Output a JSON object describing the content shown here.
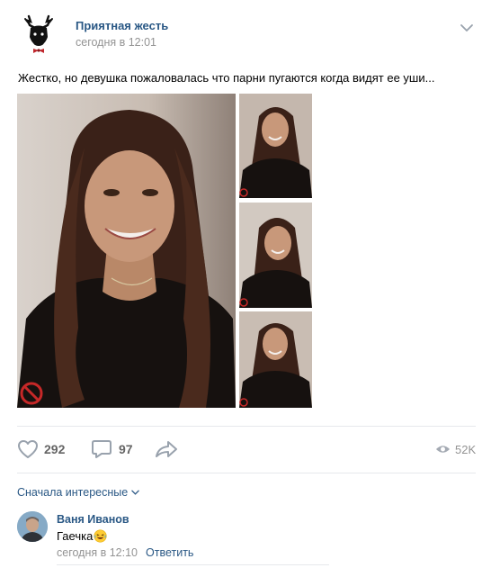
{
  "post": {
    "group_name": "Приятная жесть",
    "time": "сегодня в 12:01",
    "text": "Жестко, но девушка пожаловалась что парни пугаются когда видят ее уши..."
  },
  "actions": {
    "likes": "292",
    "comments": "97",
    "views": "52K"
  },
  "comments_section": {
    "sort_label": "Сначала интересные",
    "items": [
      {
        "author": "Ваня Иванов",
        "text": "Гаечка",
        "time": "сегодня в 12:10",
        "reply_label": "Ответить"
      }
    ]
  },
  "colors": {
    "link": "#2a5885",
    "secondary": "#939393",
    "icon": "#99a2ad"
  },
  "icons": [
    "group-logo-icon",
    "chevron-down-icon",
    "heart-icon",
    "comment-icon",
    "share-icon",
    "eye-icon",
    "sort-chevron-icon",
    "laughing-emoji-icon",
    "stop-sign-icon"
  ]
}
